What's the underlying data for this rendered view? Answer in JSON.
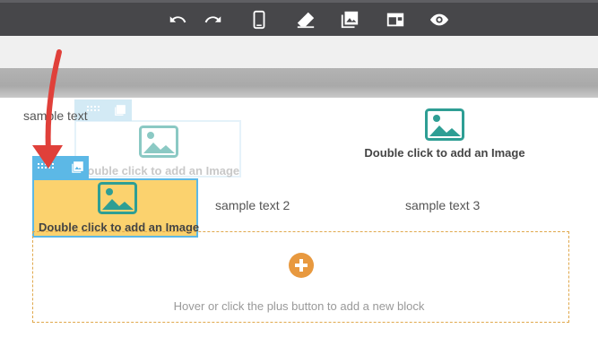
{
  "toolbar": {
    "icons": [
      "undo-icon",
      "redo-icon",
      "mobile-icon",
      "eraser-icon",
      "image-gallery-icon",
      "layout-icon",
      "preview-eye-icon"
    ]
  },
  "canvas": {
    "sample_text_1": "sample text",
    "sample_text_2": "sample text 2",
    "sample_text_3": "sample text 3",
    "image_placeholder_label": "Double click to add an Image",
    "ghost_label": "Double click to add an Image",
    "selected_label": "Double click to add an Image"
  },
  "add_block": {
    "hint": "Hover or click the plus button to add a new block"
  },
  "colors": {
    "toolbar_bg": "#47474a",
    "selection_border": "#5cb8e6",
    "selection_fill": "#fbd26e",
    "accent_orange": "#e8993f",
    "image_icon_teal": "#2e9e94",
    "arrow_red": "#e0403a"
  }
}
